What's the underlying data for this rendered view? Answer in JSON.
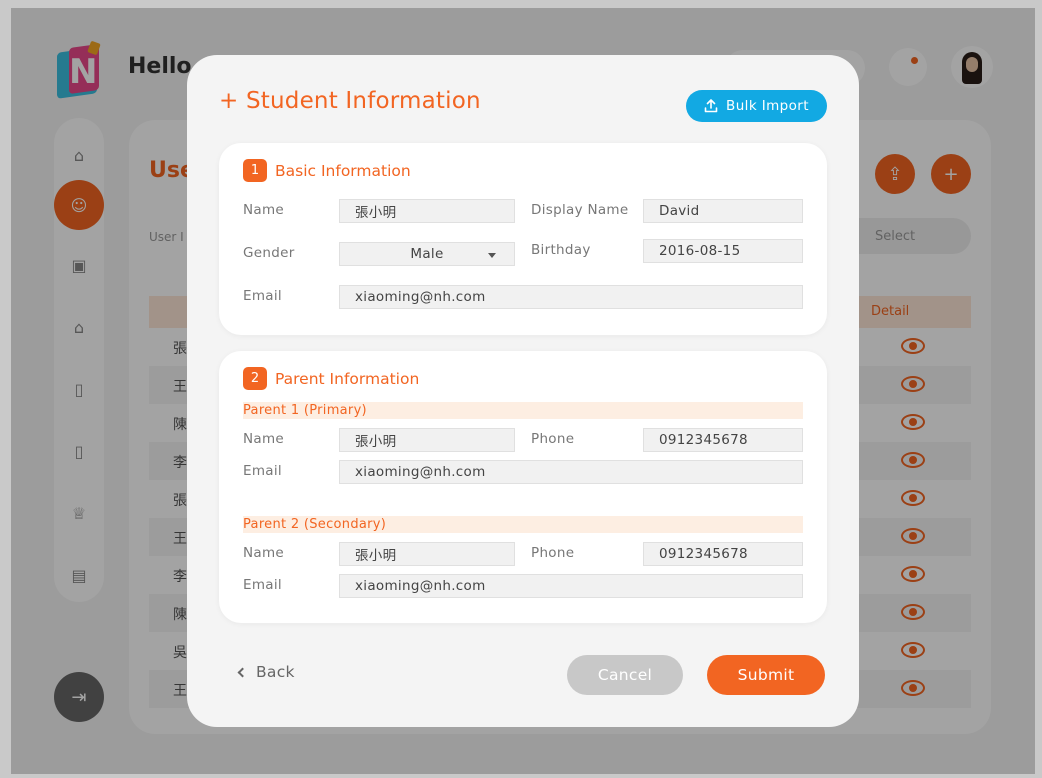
{
  "background": {
    "greeting": "Hello,",
    "section_title": "Use",
    "subtext": "User I",
    "select_placeholder": "Select",
    "table_header_detail": "Detail",
    "rows": [
      "張",
      "王",
      "陳",
      "李",
      "張",
      "王",
      "李",
      "陳",
      "吳",
      "王"
    ]
  },
  "modal": {
    "title": "+ Student Information",
    "bulk_import_label": "Bulk Import",
    "basic": {
      "number": "1",
      "title": "Basic Information",
      "name_label": "Name",
      "name_value": "張小明",
      "display_name_label": "Display Name",
      "display_name_value": "David",
      "gender_label": "Gender",
      "gender_value": "Male",
      "birthday_label": "Birthday",
      "birthday_value": "2016-08-15",
      "email_label": "Email",
      "email_value": "xiaoming@nh.com"
    },
    "parent": {
      "number": "2",
      "title": "Parent Information",
      "parent1": {
        "heading": "Parent 1   (Primary)",
        "name_label": "Name",
        "name_value": "張小明",
        "phone_label": "Phone",
        "phone_value": "0912345678",
        "email_label": "Email",
        "email_value": "xiaoming@nh.com"
      },
      "parent2": {
        "heading": "Parent 2  (Secondary)",
        "name_label": "Name",
        "name_value": "張小明",
        "phone_label": "Phone",
        "phone_value": "0912345678",
        "email_label": "Email",
        "email_value": "xiaoming@nh.com"
      }
    },
    "back_label": "Back",
    "cancel_label": "Cancel",
    "submit_label": "Submit"
  },
  "colors": {
    "accent": "#f26522",
    "info": "#12a9e3",
    "disabled": "#c8c8c8"
  }
}
